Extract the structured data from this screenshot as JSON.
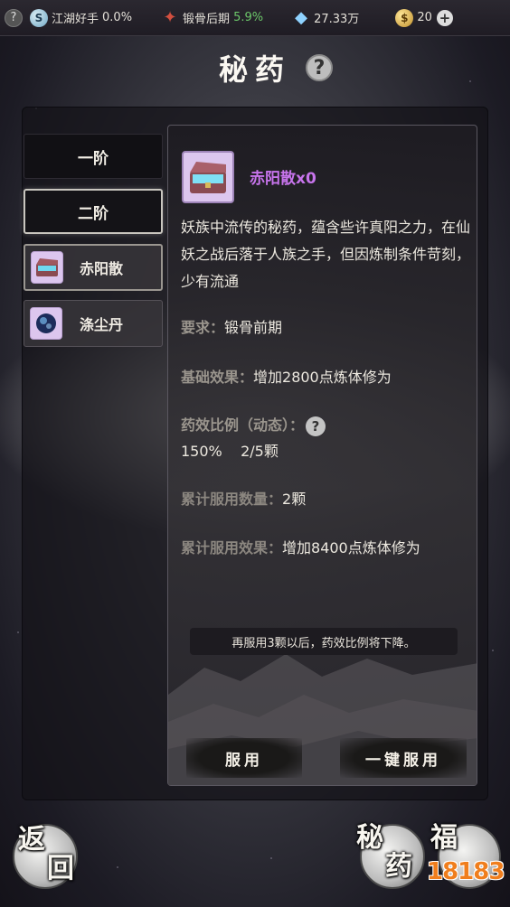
{
  "topbar": {
    "help_icon": "question-icon",
    "realm_name": "江湖好手",
    "realm_value": "0.0%",
    "stage_name": "锻骨后期",
    "stage_value": "5.9%",
    "currency_value": "27.33万",
    "coin_value": "20",
    "plus_icon": "plus-icon"
  },
  "title": "秘药",
  "tabs": {
    "tier1": "一阶",
    "tier2": "二阶"
  },
  "items": [
    {
      "name": "赤阳散",
      "icon": "chest-icon"
    },
    {
      "name": "涤尘丹",
      "icon": "orb-icon"
    }
  ],
  "detail": {
    "name": "赤阳散x0",
    "description": "妖族中流传的秘药，蕴含些许真阳之力，在仙妖之战后落于人族之手，但因炼制条件苛刻，少有流通",
    "req_label": "要求：",
    "req_value": "锻骨前期",
    "base_label": "基础效果：",
    "base_value": "增加2800点炼体修为",
    "ratio_label": "药效比例（动态）：",
    "ratio_value": "150%    2/5颗",
    "total_count_label": "累计服用数量：",
    "total_count_value": "2颗",
    "total_effect_label": "累计服用效果：",
    "total_effect_value": "增加8400点炼体修为",
    "notice": "再服用3颗以后，药效比例将下降。",
    "use_button": "服用",
    "use_all_button": "一键服用"
  },
  "bottom": {
    "back_top": "返",
    "back_bottom": "回",
    "medicine_top": "秘",
    "medicine_bottom": "药",
    "fortune": "福",
    "watermark": "18183"
  }
}
